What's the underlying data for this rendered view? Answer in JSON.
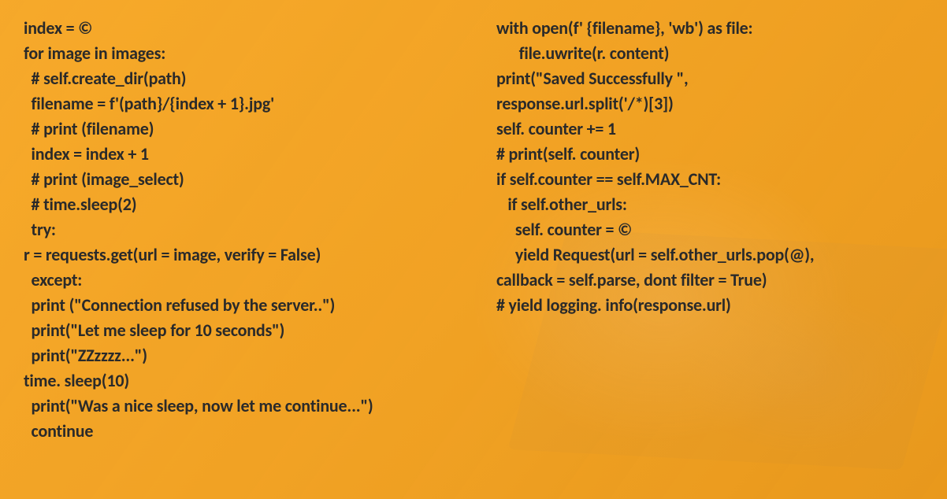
{
  "left": {
    "l0": "index = ©",
    "l1": "for image in images:",
    "l2": "  # self.create_dir(path)",
    "l3": "  filename = f'(path}/{index + 1}.jpg'",
    "l4": "  # print (filename)",
    "l5": "  index = index + 1",
    "l6": "  # print (image_select)",
    "l7": "  # time.sleep(2)",
    "l8": "  try:",
    "l9": "r = requests.get(url = image, verify = False)",
    "l10": "  except:",
    "l11": "  print (\"Connection refused by the server..\")",
    "l12": "  print(\"Let me sleep for 10 seconds\")",
    "l13": "  print(\"ZZzzzz...\")",
    "l14": "time. sleep(10)",
    "l15": "  print(\"Was a nice sleep, now let me continue...\")",
    "l16": "  continue"
  },
  "right": {
    "l0": "with open(f' {filename}, 'wb') as file:",
    "l1": "      file.uwrite(r. content)",
    "l2": "print(\"Saved Successfully \",",
    "l3": "response.url.split('/*)[3])",
    "l4": "self. counter += 1",
    "l5": "# print(self. counter)",
    "l6": "if self.counter == self.MAX_CNT:",
    "l7": "   if self.other_urls:",
    "l8": "     self. counter = ©",
    "l9": "     yield Request(url = self.other_urls.pop(@),",
    "l10": "callback = self.parse, dont filter = True)",
    "l11": "# yield logging. info(response.url)"
  }
}
